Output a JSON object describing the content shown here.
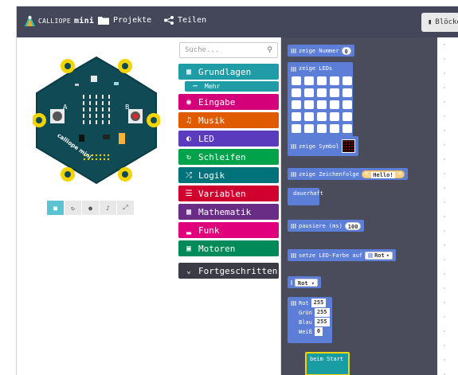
{
  "header": {
    "brand_prefix": "CALLIOPE",
    "brand_suffix": "mini",
    "projects_label": "Projekte",
    "share_label": "Teilen",
    "blocks_label": "Blöcke"
  },
  "toolbox": {
    "search_placeholder": "Suche...",
    "categories": [
      {
        "label": "Grundlagen",
        "color": "#1f9ca5"
      },
      {
        "label": "Mehr",
        "color": "#1f9ca5"
      },
      {
        "label": "Eingabe",
        "color": "#d4007a"
      },
      {
        "label": "Musik",
        "color": "#e05a00"
      },
      {
        "label": "LED",
        "color": "#5b3bbd"
      },
      {
        "label": "Schleifen",
        "color": "#00a34a"
      },
      {
        "label": "Logik",
        "color": "#00737a"
      },
      {
        "label": "Variablen",
        "color": "#d0002f"
      },
      {
        "label": "Mathematik",
        "color": "#6a2d86"
      },
      {
        "label": "Funk",
        "color": "#e0007b"
      },
      {
        "label": "Motoren",
        "color": "#008a5a"
      },
      {
        "label": "Fortgeschritten",
        "color": "#3b3b45"
      }
    ]
  },
  "blocks": {
    "show_number": "zeige Nummer",
    "show_number_value": "0",
    "show_leds": "zeige LEDs",
    "show_icon": "zeige Symbol",
    "show_string": "zeige Zeichenfolge",
    "show_string_value": "Hello!",
    "forever": "dauerhaft",
    "pause": "pausiere (ms)",
    "pause_value": "100",
    "set_led_color": "setze LED-Farbe auf",
    "color_value": "Rot",
    "color_block": "Rot",
    "rgb_red_label": "Rot",
    "rgb_red": "255",
    "rgb_green_label": "Grün",
    "rgb_green": "255",
    "rgb_blue_label": "Blau",
    "rgb_blue": "255",
    "rgb_white_label": "Weiß",
    "rgb_white": "0",
    "on_start": "beim Start"
  },
  "board_labels": {
    "a": "A",
    "b": "B",
    "n_plus": "+",
    "n_minus": "-",
    "brand": "calliope mini"
  }
}
